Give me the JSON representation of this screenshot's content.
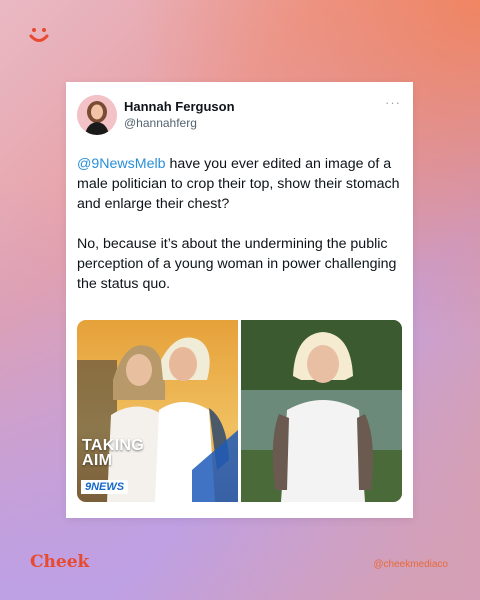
{
  "post": {
    "author_name": "Hannah Ferguson",
    "author_handle": "@hannahferg",
    "more_label": "···",
    "mention": "@9NewsMelb",
    "text_part1": " have you ever edited an image of a male politician to crop their top, show their stomach and enlarge their chest?",
    "text_part2": "No, because it’s about the undermining the public perception of a young woman in power challenging the status quo."
  },
  "media": {
    "left_overlay_line1": "TAKING",
    "left_overlay_line2": "AIM",
    "left_logo": "9NEWS"
  },
  "footer": {
    "brand": "Cheek",
    "handle": "@cheekmediaco"
  },
  "colors": {
    "mention": "#2a8fd9",
    "brand": "#e84a2f"
  }
}
